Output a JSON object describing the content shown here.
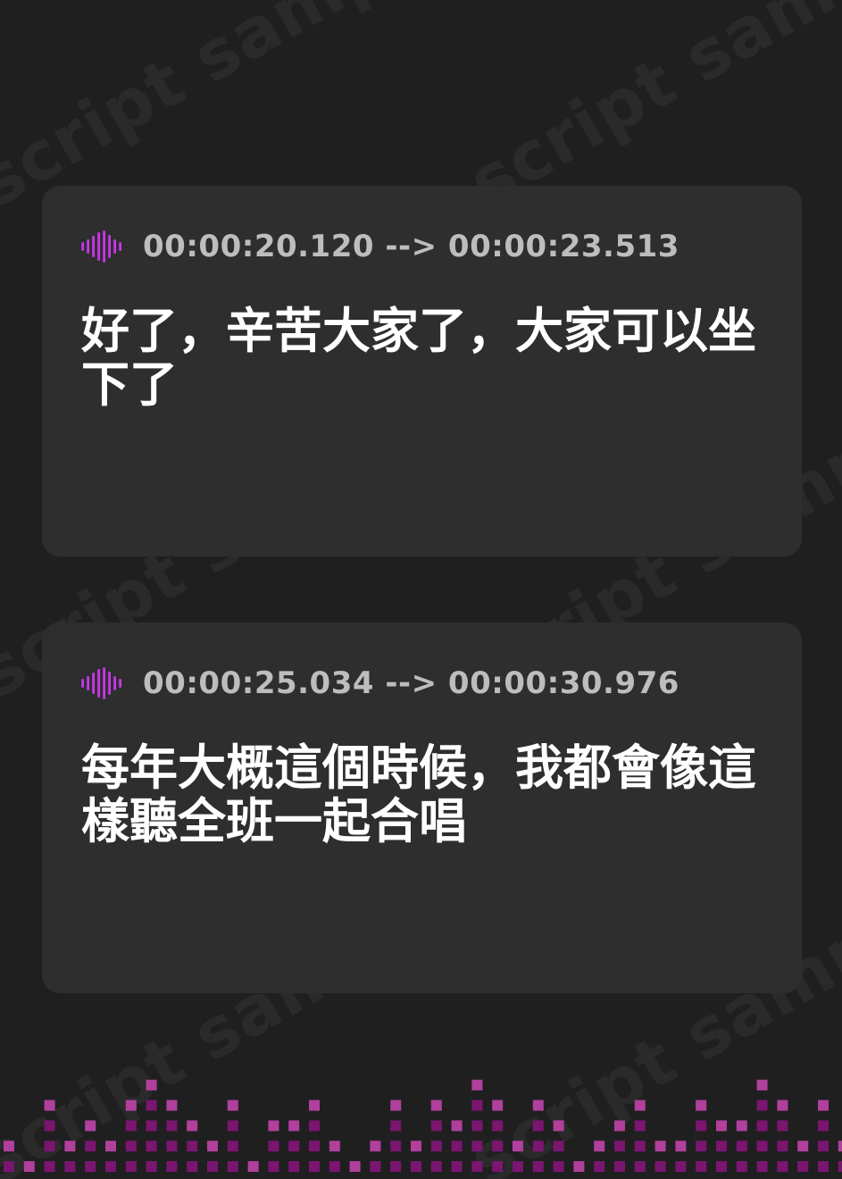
{
  "watermark": {
    "text": "script sample"
  },
  "subtitles": [
    {
      "timestamp": "00:00:20.120 --> 00:00:23.513",
      "text": "好了，辛苦大家了，大家可以坐下了"
    },
    {
      "timestamp": "00:00:25.034 --> 00:00:30.976",
      "text": "每年大概這個時候，我都會像這樣聽全班一起合唱"
    }
  ],
  "icons": {
    "timestamp_icon": "audio-wave-icon"
  },
  "colors": {
    "background": "#1f1f20",
    "card": "#2e2e2f",
    "accent_pink": "#e040c8",
    "accent_purple": "#9b2cf0",
    "timestamp_text": "#bdbdbd",
    "subtitle_text": "#ffffff",
    "equalizer_dark": "#7a1570",
    "equalizer_light": "#b0409c"
  }
}
